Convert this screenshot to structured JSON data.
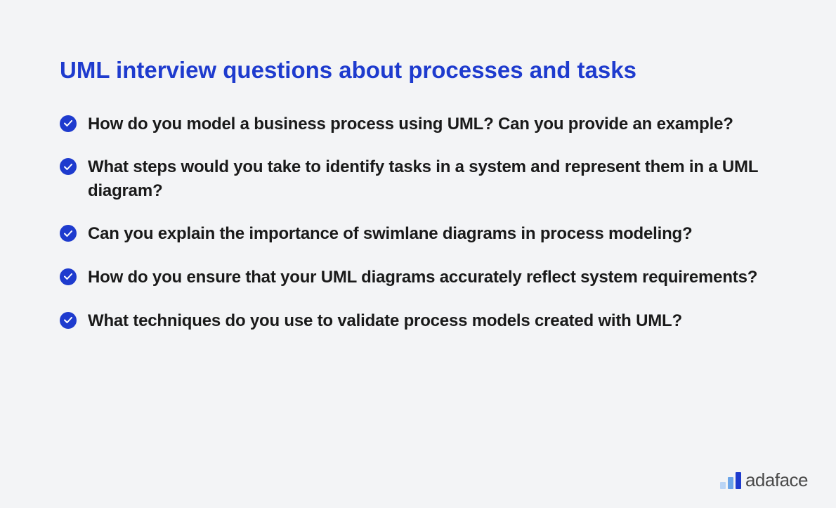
{
  "heading": "UML interview questions about processes and tasks",
  "items": [
    "How do you model a business process using UML? Can you provide an example?",
    "What steps would you take to identify tasks in a system and represent them in a UML diagram?",
    "Can you explain the importance of swimlane diagrams in process modeling?",
    "How do you ensure that your UML diagrams accurately reflect system requirements?",
    "What techniques do you use to validate process models created with UML?"
  ],
  "logo": {
    "text": "adaface"
  }
}
